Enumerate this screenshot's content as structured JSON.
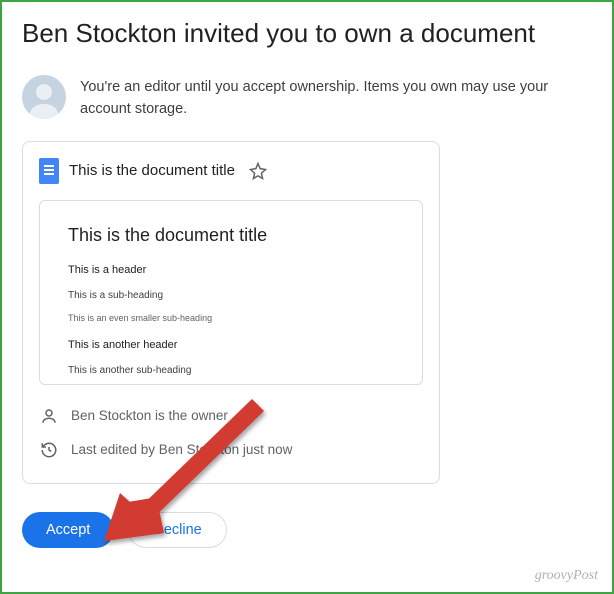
{
  "header": {
    "title": "Ben Stockton invited you to own a document"
  },
  "info": {
    "message": "You're an editor until you accept ownership. Items you own may use your account storage."
  },
  "document": {
    "title": "This is the document title",
    "preview": {
      "title": "This is the document title",
      "line_1": "This is a header",
      "line_2": "This is a sub-heading",
      "line_3": "This is an even smaller sub-heading",
      "line_4": "This is another header",
      "line_5": "This is another sub-heading"
    },
    "owner_line": "Ben Stockton is the owner",
    "edited_line": "Last edited by Ben Stockton just now"
  },
  "actions": {
    "accept": "Accept",
    "decline": "Decline"
  },
  "watermark": "groovyPost"
}
